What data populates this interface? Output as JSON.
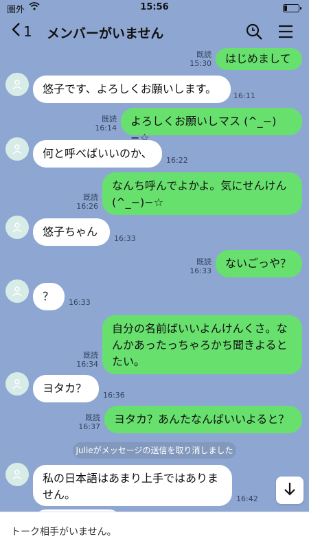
{
  "status": {
    "carrier": "圏外",
    "time": "15:56"
  },
  "header": {
    "back_count": "1",
    "title": "メンバーがいません"
  },
  "messages": [
    {
      "dir": "out",
      "text": "はじめまして",
      "read": "既読",
      "time": "15:30"
    },
    {
      "dir": "in",
      "text": "悠子です、よろしくお願いします。",
      "time": "16:11"
    },
    {
      "dir": "out",
      "text": "よろしくお願いしマス (^_−)−☆",
      "read": "既読",
      "time": "16:14"
    },
    {
      "dir": "in",
      "text": "何と呼べばいいのか、",
      "time": "16:22"
    },
    {
      "dir": "out",
      "text": "なんち呼んでよかよ。気にせんけん(^_−)−☆",
      "read": "既読",
      "time": "16:26"
    },
    {
      "dir": "in",
      "text": "悠子ちゃん",
      "time": "16:33"
    },
    {
      "dir": "out",
      "text": "ないごっや？",
      "read": "既読",
      "time": "16:33"
    },
    {
      "dir": "in",
      "text": "？",
      "time": "16:33"
    },
    {
      "dir": "out",
      "text": "自分の名前ばいいよんけんくさ。なんかあったっちゃろかち聞きよるとたい。",
      "read": "既読",
      "time": "16:34"
    },
    {
      "dir": "in",
      "text": "ヨタカ？",
      "time": "16:36"
    },
    {
      "dir": "out",
      "text": "ヨタカ？あんたなんばいいよると？",
      "read": "既読",
      "time": "16:37"
    },
    {
      "dir": "in",
      "text": "私の日本語はあまり上手ではありません。",
      "time": "16:42"
    }
  ],
  "system_notice": "Julieがメッセージの送信を取り消しました",
  "footer": {
    "text": "トーク相手がいません。"
  },
  "colors": {
    "background": "#8ea7d2",
    "outgoing": "#67e06e",
    "incoming": "#ffffff"
  },
  "icons": [
    "back-chevron-icon",
    "search-icon",
    "menu-icon",
    "avatar-icon",
    "scroll-down-icon",
    "wifi-icon",
    "battery-icon"
  ]
}
